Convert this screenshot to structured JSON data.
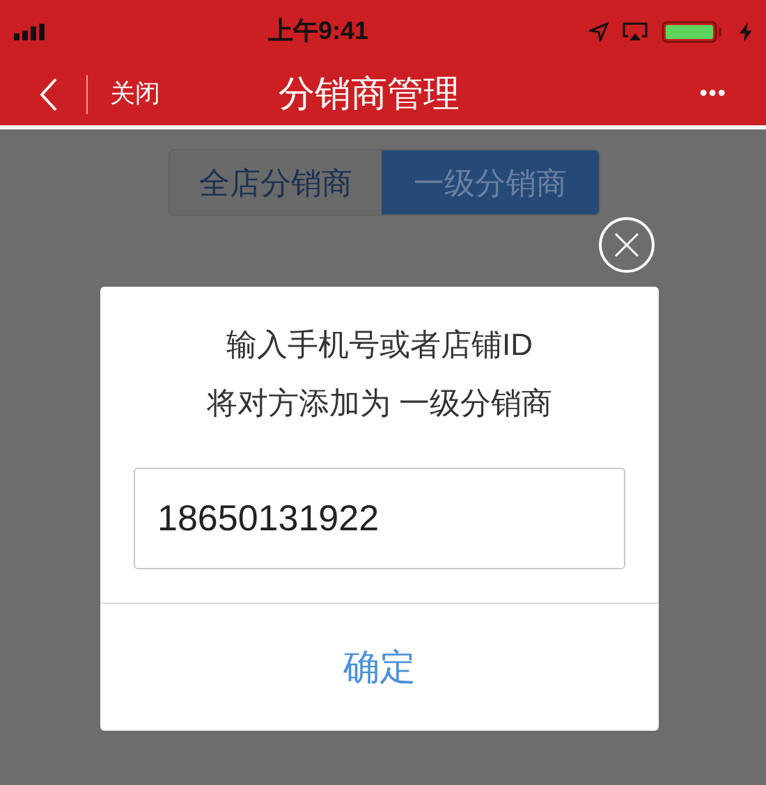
{
  "status_bar": {
    "time": "上午9:41"
  },
  "nav_bar": {
    "close": "关闭",
    "title": "分销商管理",
    "more": "•••"
  },
  "tabs": [
    {
      "label": "全店分销商",
      "selected": false
    },
    {
      "label": "一级分销商",
      "selected": true
    }
  ],
  "dialog": {
    "lines": [
      "输入手机号或者店铺ID",
      "将对方添加为 一级分销商"
    ],
    "input_value": "18650131922",
    "confirm": "确定"
  }
}
